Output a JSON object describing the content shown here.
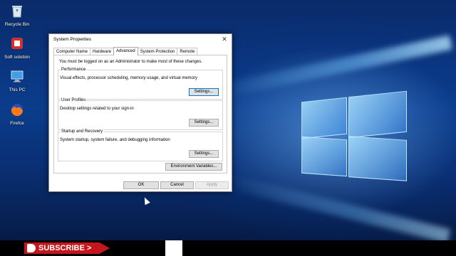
{
  "desktop": {
    "icons": [
      {
        "label": "Recycle Bin",
        "icon": "recycle-bin-icon"
      },
      {
        "label": "Soft solution",
        "icon": "app-icon"
      },
      {
        "label": "This PC",
        "icon": "computer-icon"
      },
      {
        "label": "Firefox",
        "icon": "firefox-icon"
      }
    ]
  },
  "dialog": {
    "title": "System Properties",
    "close": "✕",
    "tabs": [
      "Computer Name",
      "Hardware",
      "Advanced",
      "System Protection",
      "Remote"
    ],
    "active_tab": "Advanced",
    "admin_message": "You must be logged on as an Administrator to make most of these changes.",
    "groups": [
      {
        "title": "Performance",
        "description": "Visual effects, processor scheduling, memory usage, and virtual memory",
        "button": "Settings..."
      },
      {
        "title": "User Profiles",
        "description": "Desktop settings related to your sign-in",
        "button": "Settings..."
      },
      {
        "title": "Startup and Recovery",
        "description": "System startup, system failure, and debugging information",
        "button": "Settings..."
      }
    ],
    "env_button": "Environment Variables...",
    "ok": "OK",
    "cancel": "Cancel",
    "apply": "Apply"
  },
  "taskbar": {
    "subscribe_label": "SUBSCRIBE",
    "subscribe_arrow": ">"
  }
}
